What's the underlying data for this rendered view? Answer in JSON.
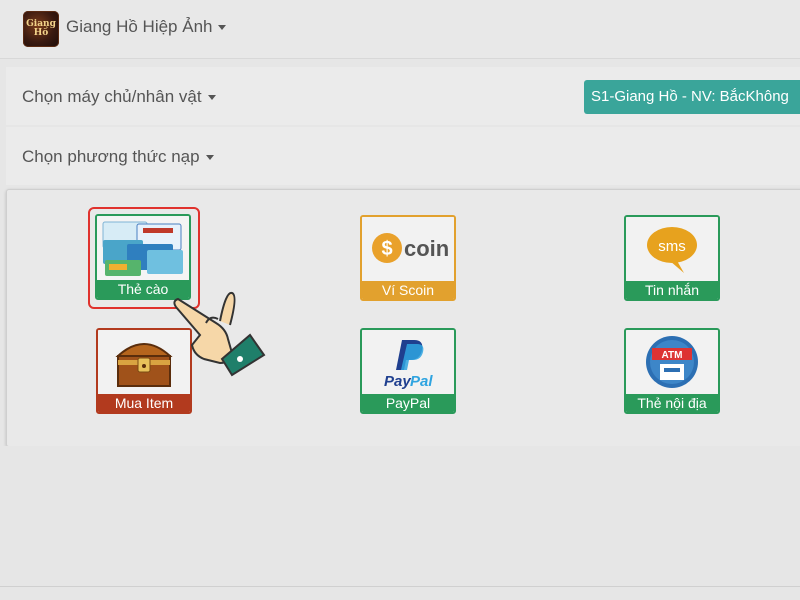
{
  "header": {
    "game_name": "Giang Hồ Hiệp Ảnh",
    "logo_text_1": "Giang",
    "logo_text_2": "Hồ"
  },
  "server_row": {
    "label": "Chọn máy chủ/nhân vật",
    "selected_value": "S1-Giang Hồ - NV: BắcKhông"
  },
  "method_row": {
    "label": "Chọn phương thức nạp"
  },
  "methods": [
    {
      "label": "Thẻ cào",
      "icon": "phone-cards-icon",
      "color": "#2a9a5a",
      "selected": true
    },
    {
      "label": "Ví Scoin",
      "icon": "scoin-icon",
      "color": "#e2a12e"
    },
    {
      "label": "Tin nhắn",
      "icon": "sms-bubble-icon",
      "color": "#2a9a5a"
    },
    {
      "label": "Mua Item",
      "icon": "treasure-chest-icon",
      "color": "#b23a1e"
    },
    {
      "label": "PayPal",
      "icon": "paypal-icon",
      "color": "#2a9a5a"
    },
    {
      "label": "Thẻ nội địa",
      "icon": "atm-card-icon",
      "color": "#2a9a5a"
    }
  ],
  "icon_text": {
    "scoin": "coin",
    "sms": "sms",
    "paypal_1": "Pay",
    "paypal_2": "Pal",
    "atm": "ATM"
  }
}
